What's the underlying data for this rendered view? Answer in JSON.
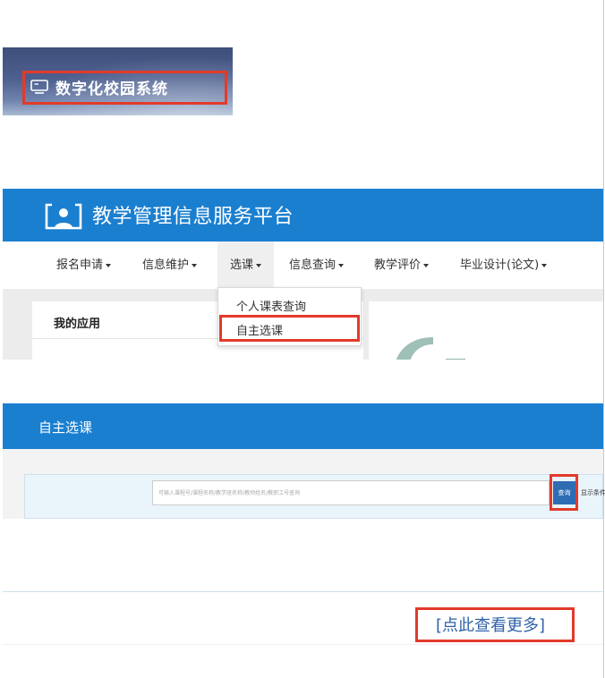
{
  "campus_banner": {
    "icon": "monitor-icon",
    "title": "数字化校园系统"
  },
  "platform": {
    "logo_icon": "user-monitor-icon",
    "title": "教学管理信息服务平台",
    "nav": [
      {
        "label": "报名申请"
      },
      {
        "label": "信息维护"
      },
      {
        "label": "选课"
      },
      {
        "label": "信息查询"
      },
      {
        "label": "教学评价"
      },
      {
        "label": "毕业设计(论文)"
      }
    ],
    "dropdown": [
      {
        "label": "个人课表查询"
      },
      {
        "label": "自主选课"
      }
    ],
    "apps_title": "我的应用"
  },
  "course_select": {
    "title": "自主选课",
    "search_placeholder": "可输入课程号/课程名称/教学班名称/教师姓名/教职工号查询",
    "search_button": "查询",
    "search_options": "显示条件"
  },
  "more": {
    "link_text": "[点此查看更多]"
  },
  "colors": {
    "header_blue": "#1b7fd0",
    "highlight_red": "#e23a2a",
    "link_blue": "#2e62a8"
  }
}
